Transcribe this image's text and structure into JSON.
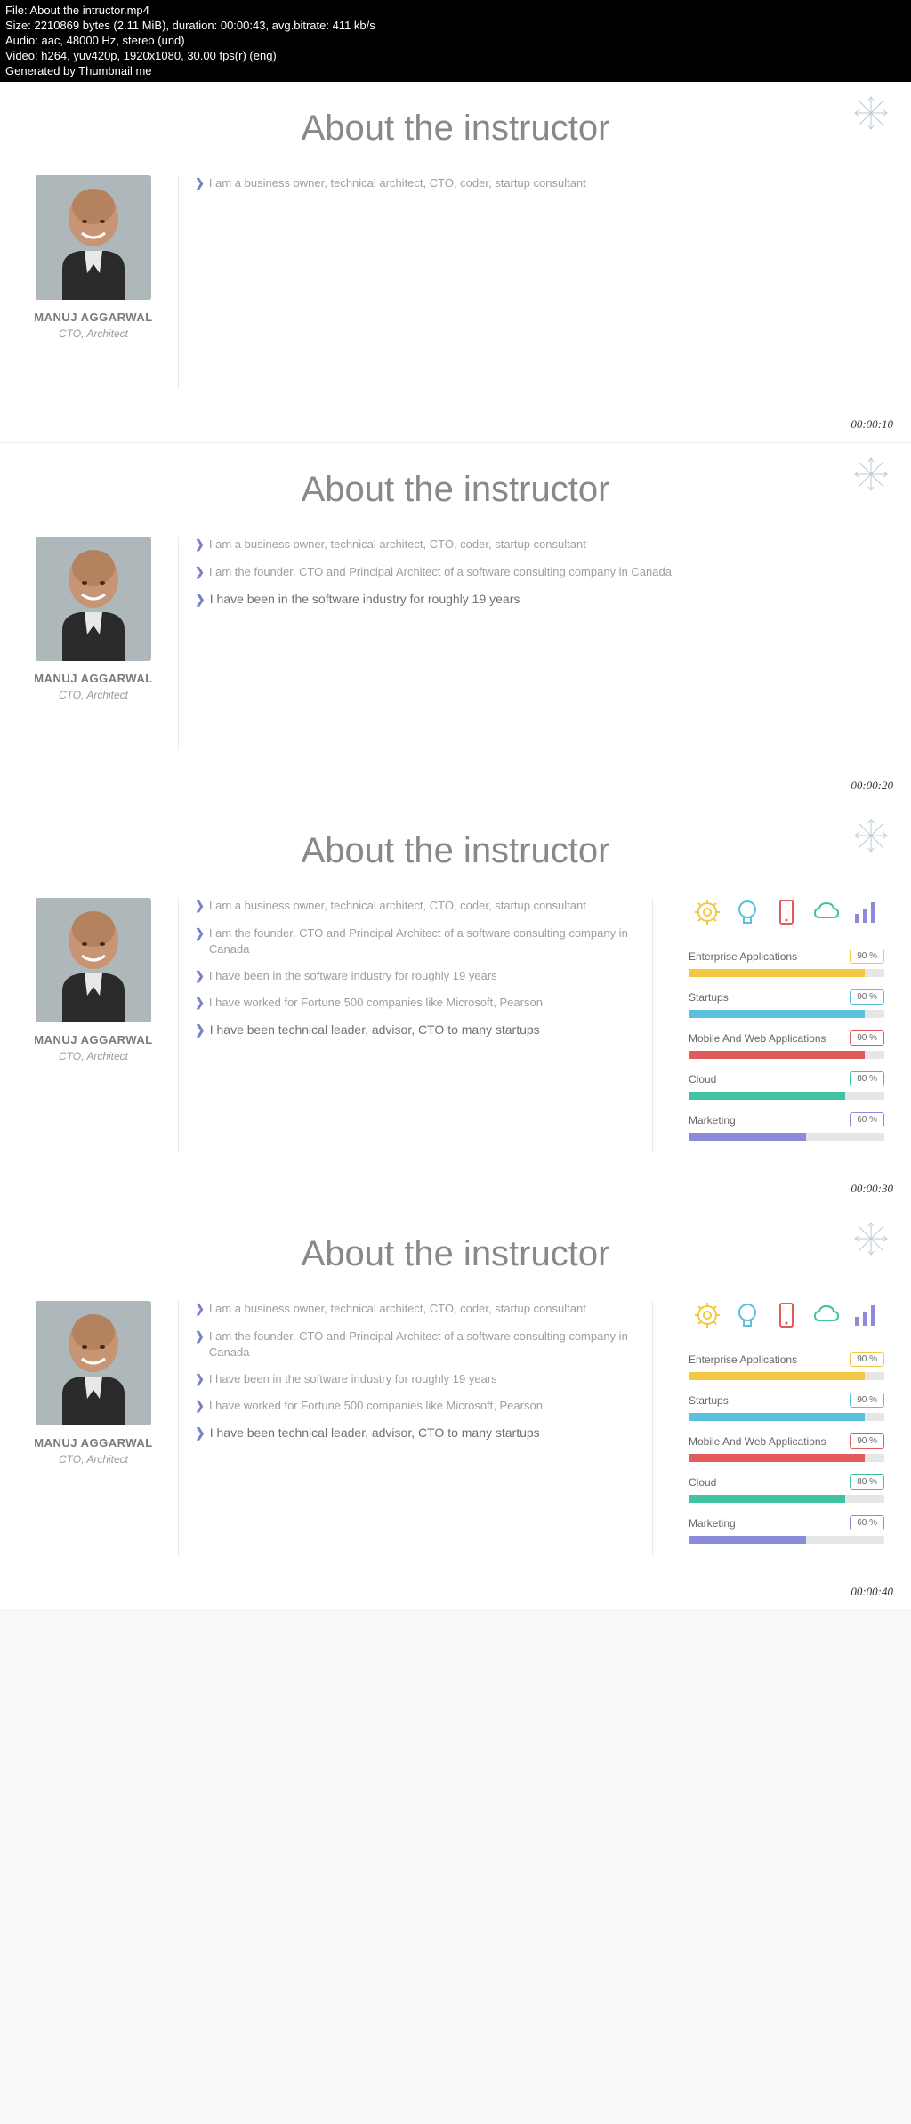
{
  "header": {
    "file": "File: About the intructor.mp4",
    "size": "Size: 2210869 bytes (2.11 MiB), duration: 00:00:43, avg.bitrate: 411 kb/s",
    "audio": "Audio: aac, 48000 Hz, stereo (und)",
    "video": "Video: h264, yuv420p, 1920x1080, 30.00 fps(r) (eng)",
    "generated": "Generated by Thumbnail me"
  },
  "instructor": {
    "name": "MANUJ AGGARWAL",
    "role": "CTO, Architect"
  },
  "title": "About the instructor",
  "bullets": {
    "b1": "I am a business owner, technical architect, CTO, coder, startup consultant",
    "b2": "I am the founder, CTO and Principal Architect of a software consulting company in Canada",
    "b3": "I have been in the software industry for roughly 19 years",
    "b4": "I have worked for Fortune 500 companies like Microsoft, Pearson",
    "b5": "I have been technical leader, advisor, CTO to many startups"
  },
  "skills": [
    {
      "label": "Enterprise Applications",
      "value": "90 %",
      "pct": 90,
      "color": "#f3c842",
      "border": "#f3c842"
    },
    {
      "label": "Startups",
      "value": "90 %",
      "pct": 90,
      "color": "#5bc0de",
      "border": "#5bc0de"
    },
    {
      "label": "Mobile And Web Applications",
      "value": "90 %",
      "pct": 90,
      "color": "#e15b5b",
      "border": "#e15b5b"
    },
    {
      "label": "Cloud",
      "value": "80 %",
      "pct": 80,
      "color": "#3fc4a0",
      "border": "#3fc4a0"
    },
    {
      "label": "Marketing",
      "value": "60 %",
      "pct": 60,
      "color": "#8b8cd9",
      "border": "#8b8cd9"
    }
  ],
  "timestamps": {
    "t1": "00:00:10",
    "t2": "00:00:20",
    "t3": "00:00:30",
    "t4": "00:00:40"
  }
}
